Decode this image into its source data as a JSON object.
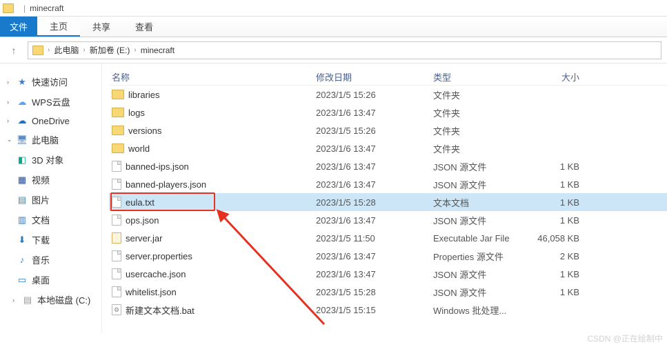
{
  "window": {
    "title": "minecraft",
    "separator": "|"
  },
  "tabs": {
    "file": "文件",
    "home": "主页",
    "share": "共享",
    "view": "查看"
  },
  "breadcrumb": {
    "seg1": "此电脑",
    "seg2": "新加卷 (E:)",
    "seg3": "minecraft"
  },
  "columns": {
    "name": "名称",
    "date": "修改日期",
    "type": "类型",
    "size": "大小"
  },
  "nav": {
    "quick": "快速访问",
    "wps": "WPS云盘",
    "onedrive": "OneDrive",
    "pc": "此电脑",
    "obj3d": "3D 对象",
    "video": "视频",
    "pic": "图片",
    "doc": "文档",
    "dl": "下载",
    "music": "音乐",
    "desktop": "桌面",
    "disk_c": "本地磁盘 (C:)"
  },
  "rows": [
    {
      "icon": "folder",
      "name": "libraries",
      "date": "2023/1/5 15:26",
      "type": "文件夹",
      "size": ""
    },
    {
      "icon": "folder",
      "name": "logs",
      "date": "2023/1/6 13:47",
      "type": "文件夹",
      "size": ""
    },
    {
      "icon": "folder",
      "name": "versions",
      "date": "2023/1/5 15:26",
      "type": "文件夹",
      "size": ""
    },
    {
      "icon": "folder",
      "name": "world",
      "date": "2023/1/6 13:47",
      "type": "文件夹",
      "size": ""
    },
    {
      "icon": "file",
      "name": "banned-ips.json",
      "date": "2023/1/6 13:47",
      "type": "JSON 源文件",
      "size": "1 KB"
    },
    {
      "icon": "file",
      "name": "banned-players.json",
      "date": "2023/1/6 13:47",
      "type": "JSON 源文件",
      "size": "1 KB"
    },
    {
      "icon": "file",
      "name": "eula.txt",
      "date": "2023/1/5 15:28",
      "type": "文本文档",
      "size": "1 KB",
      "selected": true
    },
    {
      "icon": "file",
      "name": "ops.json",
      "date": "2023/1/6 13:47",
      "type": "JSON 源文件",
      "size": "1 KB"
    },
    {
      "icon": "jar",
      "name": "server.jar",
      "date": "2023/1/5 11:50",
      "type": "Executable Jar File",
      "size": "46,058 KB"
    },
    {
      "icon": "file",
      "name": "server.properties",
      "date": "2023/1/6 13:47",
      "type": "Properties 源文件",
      "size": "2 KB"
    },
    {
      "icon": "file",
      "name": "usercache.json",
      "date": "2023/1/6 13:47",
      "type": "JSON 源文件",
      "size": "1 KB"
    },
    {
      "icon": "file",
      "name": "whitelist.json",
      "date": "2023/1/5 15:28",
      "type": "JSON 源文件",
      "size": "1 KB"
    },
    {
      "icon": "bat",
      "name": "新建文本文档.bat",
      "date": "2023/1/5 15:15",
      "type": "Windows 批处理...",
      "size": ""
    }
  ],
  "watermark": "CSDN @正在绘制中"
}
